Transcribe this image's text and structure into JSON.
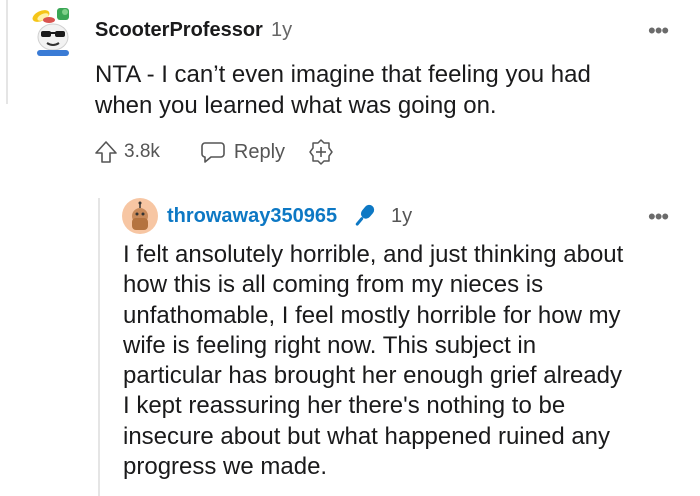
{
  "comment": {
    "author": "ScooterProfessor",
    "age": "1y",
    "more": "•••",
    "body_lines": [
      "NTA - I can’t even imagine that feeling you had",
      "when you learned what was going on."
    ],
    "votes": "3.8k",
    "reply_label": "Reply",
    "icons": [
      "upvote-icon",
      "reply-icon",
      "award-icon"
    ]
  },
  "reply": {
    "author": "throwaway350965",
    "age": "1y",
    "more": "•••",
    "badge_icon": "microphone-icon",
    "accent": "#0d78c4",
    "body_lines": [
      "I felt ansolutely horrible, and just thinking about",
      "how this is all coming from my nieces is",
      "unfathomable, I feel mostly horrible for how my",
      "wife is feeling right now. This subject in",
      "particular has brought her enough grief already",
      "I kept reassuring her there's nothing to be",
      "insecure about but what happened ruined any",
      "progress we made."
    ]
  }
}
